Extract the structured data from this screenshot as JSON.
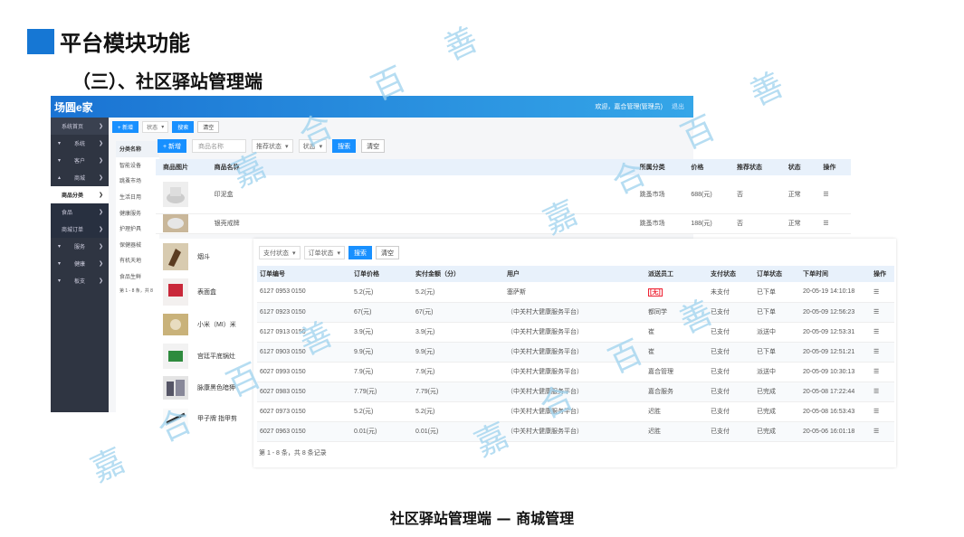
{
  "slide": {
    "title": "平台模块功能",
    "subtitle": "（三）、社区驿站管理端",
    "caption": "社区驿站管理端 — 商城管理",
    "accent_color": "#1677d4",
    "watermark_chars": [
      "嘉",
      "合",
      "百",
      "善"
    ]
  },
  "app": {
    "logo": "场圆e家",
    "welcome": "欢迎，嘉合管理(管理员)",
    "logout": "退出",
    "header_color": "#1a73d3",
    "sidebar": {
      "items": [
        {
          "label": "系统首页",
          "type": "top"
        },
        {
          "label": "系统",
          "type": "group"
        },
        {
          "label": "客户",
          "type": "group"
        },
        {
          "label": "商城",
          "type": "group"
        },
        {
          "label": "商品分类",
          "type": "active"
        },
        {
          "label": "食品",
          "type": "sub"
        },
        {
          "label": "商城订单",
          "type": "sub"
        },
        {
          "label": "服务",
          "type": "group"
        },
        {
          "label": "健康",
          "type": "group"
        },
        {
          "label": "板支",
          "type": "group"
        }
      ]
    },
    "toolbar1": {
      "add": "+ 新增",
      "status": "状态",
      "search": "搜索",
      "clear": "清空"
    },
    "categories": {
      "header": "分类名称",
      "items": [
        "智能设备",
        "跳蚤市场",
        "生活日用",
        "健康服务",
        "护理护具",
        "保健器械",
        "有机天地",
        "食品生鲜"
      ],
      "footer": "第 1 - 8 条，共 8"
    },
    "toolbar2": {
      "add": "+ 新增",
      "name_placeholder": "商品名称",
      "recommend": "推荐状态",
      "status": "状态",
      "search": "搜索",
      "clear": "清空"
    },
    "products": {
      "columns": [
        "商品图片",
        "商品名称",
        "所属分类",
        "价格",
        "推荐状态",
        "状态",
        "操作"
      ],
      "rows": [
        {
          "name": "印泥盒",
          "category": "跳蚤市场",
          "price": "688(元)",
          "recommend": "否",
          "status": "正常"
        },
        {
          "name": "银壳戒牌",
          "category": "跳蚤市场",
          "price": "188(元)",
          "recommend": "否",
          "status": "正常"
        },
        {
          "name": "烟斗"
        },
        {
          "name": "表面盒"
        },
        {
          "name": "小米（MI）米"
        },
        {
          "name": "宫廷平底锅灶"
        },
        {
          "name": "脉康黑色暗狎"
        },
        {
          "name": "甲子牌 指甲剪"
        }
      ]
    },
    "orders": {
      "toolbar": {
        "pay_status": "支付状态",
        "order_status": "订单状态",
        "search": "搜索",
        "clear": "清空"
      },
      "columns": [
        "订单编号",
        "订单价格",
        "实付金额（分）",
        "用户",
        "派送员工",
        "支付状态",
        "订单状态",
        "下单时间",
        "操作"
      ],
      "rows": [
        {
          "id": "6127 0953 0150",
          "price": "5.2(元)",
          "paid": "5.2(元)",
          "user": "塞萨斯",
          "staff": "[无]",
          "pay": "未支付",
          "state": "已下单",
          "time": "20-05-19 14:10:18"
        },
        {
          "id": "6127 0923 0150",
          "price": "67(元)",
          "paid": "67(元)",
          "user": "（中关村大健康服务平台）",
          "staff": "都同学",
          "pay": "已支付",
          "state": "已下单",
          "time": "20-05-09 12:56:23"
        },
        {
          "id": "6127 0913 0150",
          "price": "3.9(元)",
          "paid": "3.9(元)",
          "user": "（中关村大健康服务平台）",
          "staff": "崔",
          "pay": "已支付",
          "state": "派送中",
          "time": "20-05-09 12:53:31"
        },
        {
          "id": "6127 0903 0150",
          "price": "9.9(元)",
          "paid": "9.9(元)",
          "user": "（中关村大健康服务平台）",
          "staff": "崔",
          "pay": "已支付",
          "state": "已下单",
          "time": "20-05-09 12:51:21"
        },
        {
          "id": "6027 0993 0150",
          "price": "7.9(元)",
          "paid": "7.9(元)",
          "user": "（中关村大健康服务平台）",
          "staff": "嘉合管理",
          "pay": "已支付",
          "state": "派送中",
          "time": "20-05-09 10:30:13"
        },
        {
          "id": "6027 0983 0150",
          "price": "7.79(元)",
          "paid": "7.79(元)",
          "user": "（中关村大健康服务平台）",
          "staff": "嘉合服务",
          "pay": "已支付",
          "state": "已完成",
          "time": "20-05-08 17:22:44"
        },
        {
          "id": "6027 0973 0150",
          "price": "5.2(元)",
          "paid": "5.2(元)",
          "user": "（中关村大健康服务平台）",
          "staff": "迟胜",
          "pay": "已支付",
          "state": "已完成",
          "time": "20-05-08 16:53:43"
        },
        {
          "id": "6027 0963 0150",
          "price": "0.01(元)",
          "paid": "0.01(元)",
          "user": "（中关村大健康服务平台）",
          "staff": "迟胜",
          "pay": "已支付",
          "state": "已完成",
          "time": "20-05-06 16:01:18"
        }
      ],
      "pager": "第 1 - 8 条，共 8 条记录"
    }
  }
}
